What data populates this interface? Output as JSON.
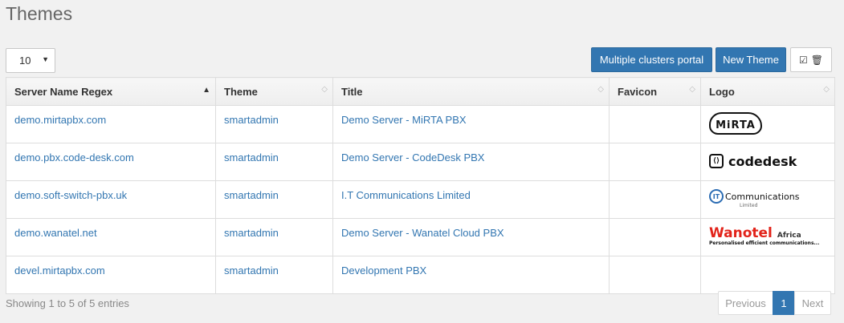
{
  "page": {
    "title": "Themes"
  },
  "toolbar": {
    "page_length": "10",
    "clusters_label": "Multiple clusters portal",
    "new_theme_label": "New Theme"
  },
  "table": {
    "columns": [
      "Server Name Regex",
      "Theme",
      "Title",
      "Favicon",
      "Logo"
    ],
    "rows": [
      {
        "server": "demo.mirtapbx.com",
        "theme": "smartadmin",
        "title": "Demo Server - MiRTA PBX",
        "logo": "MiRTA"
      },
      {
        "server": "demo.pbx.code-desk.com",
        "theme": "smartadmin",
        "title": "Demo Server - CodeDesk PBX",
        "logo": "codedesk"
      },
      {
        "server": "demo.soft-switch-pbx.uk",
        "theme": "smartadmin",
        "title": "I.T Communications Limited",
        "logo": "Communications"
      },
      {
        "server": "demo.wanatel.net",
        "theme": "smartadmin",
        "title": "Demo Server - Wanatel Cloud PBX",
        "logo": "Wanatel"
      },
      {
        "server": "devel.mirtapbx.com",
        "theme": "smartadmin",
        "title": "Development PBX",
        "logo": ""
      }
    ]
  },
  "logos": {
    "mirta": "MiRTA",
    "codedesk": "codedesk",
    "it_mark": "IT",
    "it_name": "Communications",
    "it_sub": "Limited",
    "wanatel_name": "Wanotel",
    "wanatel_region": "Africa",
    "wanatel_tagline": "Personalised efficient communications..."
  },
  "footer": {
    "info": "Showing 1 to 5 of 5 entries",
    "prev": "Previous",
    "current_page": "1",
    "next": "Next"
  },
  "colors": {
    "primary": "#3276b1",
    "link": "#3276b1",
    "wanatel_red": "#e2231a"
  },
  "icons": {
    "sort_asc": "triangle-up",
    "sort_both": "double-chevron",
    "tools": "checkbox-and-trash"
  }
}
